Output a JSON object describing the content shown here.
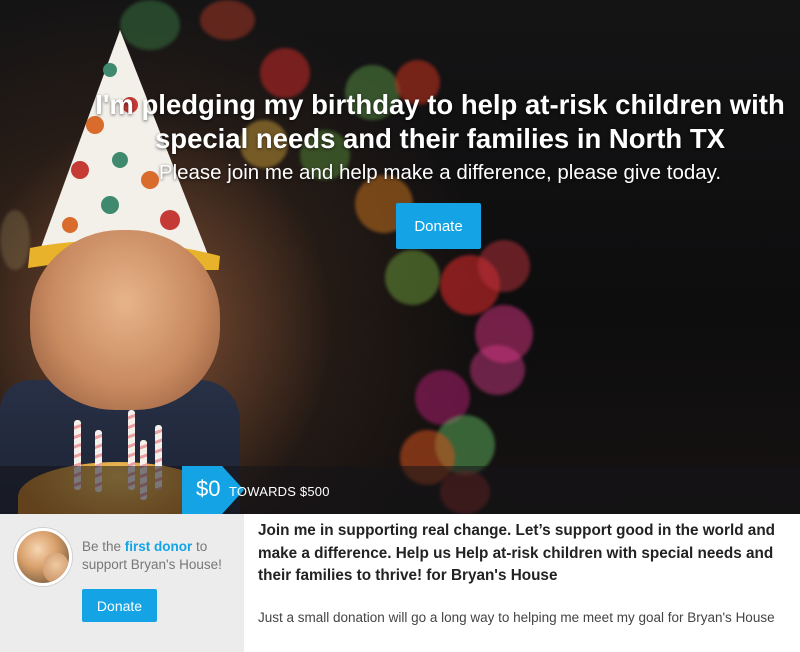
{
  "hero": {
    "title": "I'm pledging my birthday to help at-risk children with special needs and their families in North TX",
    "subtitle": "Please join me and help make a difference, please give today.",
    "donate_label": "Donate"
  },
  "progress": {
    "raised": "$0",
    "goal_text": "TOWARDS $500",
    "raised_amount": 0,
    "goal_amount": 500
  },
  "sidebar": {
    "prefix": "Be the ",
    "link": "first donor",
    "suffix": " to support Bryan's House!",
    "donate_label": "Donate"
  },
  "main": {
    "heading": "Join me in supporting real change. Let’s support good in the world and make a difference. Help us Help at-risk children with special needs and their families to thrive! for Bryan's House",
    "body": "Just a small donation will go a long way to helping me meet my goal for Bryan's House"
  },
  "colors": {
    "accent": "#14a4e6",
    "sidebar_bg": "#ececec",
    "hero_bg": "#111111"
  }
}
